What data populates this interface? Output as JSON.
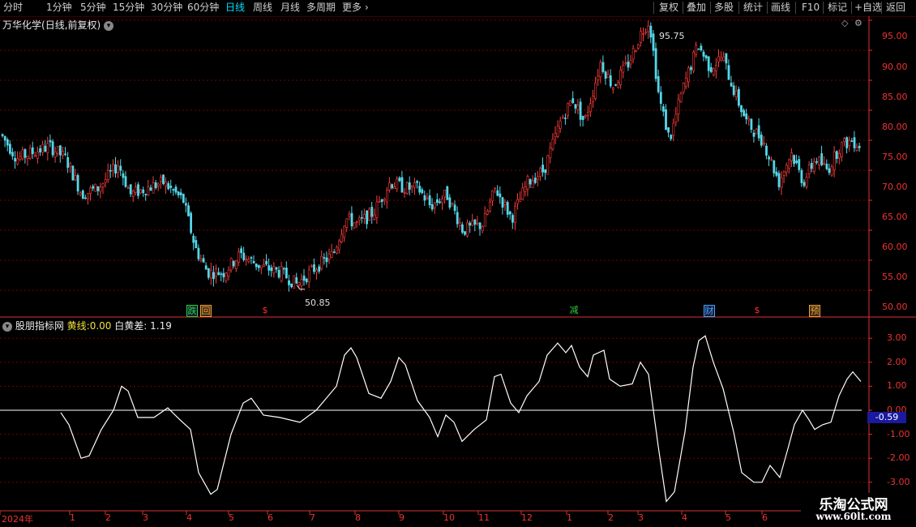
{
  "toolbar": {
    "left_items": [
      "分时",
      "1分钟",
      "5分钟",
      "15分钟",
      "30分钟",
      "60分钟",
      "日线",
      "周线",
      "月线",
      "多周期",
      "更多"
    ],
    "more_arrow": "›",
    "selected": "日线",
    "right_items": [
      "复权",
      "叠加",
      "多股",
      "统计",
      "画线",
      "F10",
      "标记",
      "+自选",
      "返回"
    ]
  },
  "price_pane": {
    "stock_name": "万华化学",
    "period_label": "(日线,前复权)",
    "high_label": "95.75",
    "low_label": "50.85",
    "y_ticks": [
      "95.00",
      "90.00",
      "85.00",
      "80.00",
      "75.00",
      "70.00",
      "65.00",
      "60.00",
      "55.00",
      "50.00"
    ],
    "event_tags": [
      {
        "text": "跌",
        "color": "#2ecc40"
      },
      {
        "text": "回",
        "color": "#f0a040"
      },
      {
        "text": "$",
        "color": "#ff3030"
      },
      {
        "text": "减",
        "color": "#2ecc40"
      },
      {
        "text": "财",
        "color": "#4aa0ff"
      },
      {
        "text": "$",
        "color": "#ff3030"
      },
      {
        "text": "预",
        "color": "#f0a040"
      }
    ]
  },
  "indicator_pane": {
    "name": "股朋指标网",
    "yellow_label": "黄线:",
    "yellow_value": "0.00",
    "white_label": "白黄差:",
    "white_value": "1.19",
    "y_ticks": [
      "3.00",
      "2.00",
      "1.00",
      "0.00",
      "-1.00",
      "-2.00",
      "-3.00"
    ],
    "current_badge": "-0.59"
  },
  "x_axis": {
    "labels": [
      "2024年",
      "1",
      "2",
      "3",
      "4",
      "5",
      "6",
      "7",
      "8",
      "9",
      "10",
      "11",
      "12",
      "1",
      "2",
      "3",
      "4",
      "5",
      "6"
    ]
  },
  "watermark": {
    "title": "乐淘公式网",
    "url": "www.60lt.com"
  },
  "colors": {
    "up": "#ff3c3c",
    "down": "#54d7e8",
    "grid": "#7a0000",
    "axis": "#e03030",
    "line": "#ffffff"
  },
  "icons": [
    "chevron-down-icon",
    "diamond-icon",
    "settings-icon"
  ]
}
